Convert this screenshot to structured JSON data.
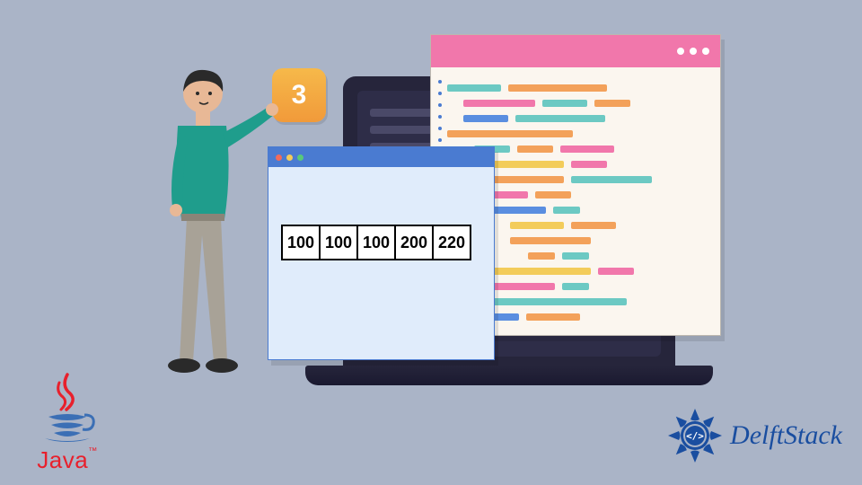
{
  "badge": {
    "value": "3"
  },
  "array": {
    "cells": [
      "100",
      "100",
      "100",
      "200",
      "220"
    ]
  },
  "logos": {
    "java": {
      "text": "Java",
      "tm": "™"
    },
    "delftstack": {
      "text": "DelftStack",
      "code_glyph": "</>"
    }
  },
  "colors": {
    "background": "#aab4c7",
    "accent_pink": "#f177ab",
    "accent_blue": "#4a7bd1",
    "accent_orange": "#f6b94a",
    "java_red": "#e8202c",
    "delft_blue": "#1a4ea0"
  },
  "icons": {
    "window_dots": [
      "dot",
      "dot",
      "dot"
    ],
    "traffic_lights": [
      "red",
      "yellow",
      "green"
    ]
  }
}
